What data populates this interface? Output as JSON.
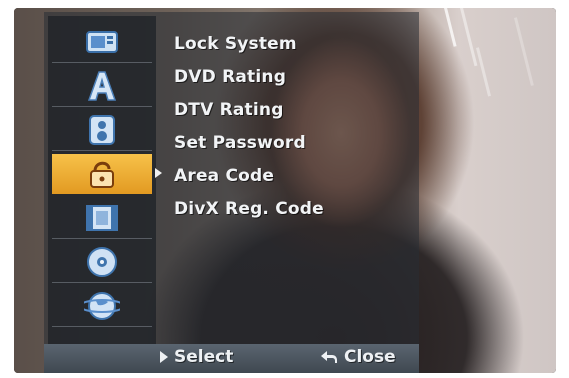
{
  "menu": {
    "items": [
      {
        "label": "Lock System"
      },
      {
        "label": "DVD Rating"
      },
      {
        "label": "DTV Rating"
      },
      {
        "label": "Set Password"
      },
      {
        "label": "Area Code"
      },
      {
        "label": "DivX Reg. Code"
      }
    ],
    "categories": [
      {
        "icon": "disc-menu-icon"
      },
      {
        "icon": "language-icon"
      },
      {
        "icon": "audio-icon"
      },
      {
        "icon": "lock-icon",
        "selected": true
      },
      {
        "icon": "film-icon"
      },
      {
        "icon": "disc-icon"
      },
      {
        "icon": "globe-icon"
      }
    ]
  },
  "footer": {
    "select_label": "Select",
    "close_label": "Close",
    "select_icon": "play-icon",
    "close_icon": "return-icon"
  },
  "colors": {
    "selected_tab": "#f0b038",
    "menu_text": "#f2f4f6",
    "panel": "#2c3238"
  }
}
